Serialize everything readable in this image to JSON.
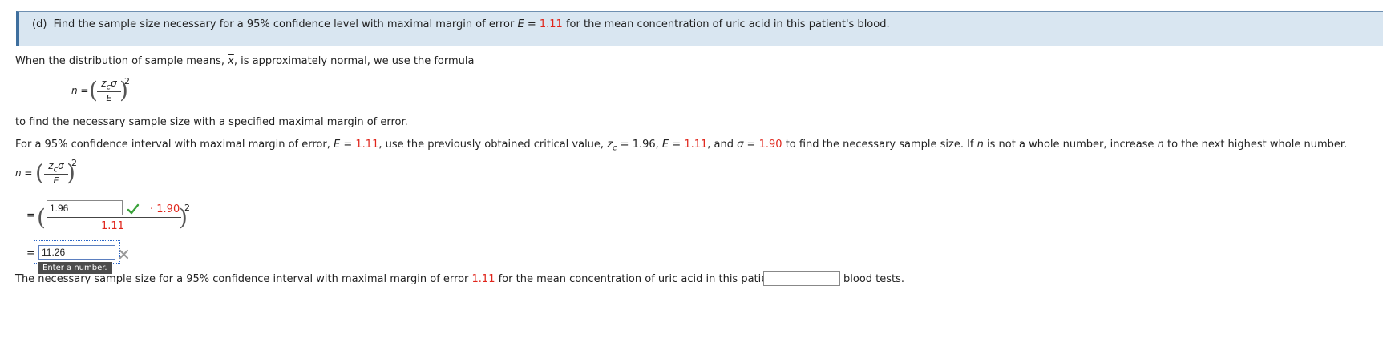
{
  "question": {
    "part": "(d)",
    "prefix": "Find the sample size necessary for a 95% confidence level with maximal margin of error",
    "E_symbol": "E",
    "eq": "=",
    "E_value": "1.11",
    "suffix": "for the mean concentration of uric acid in this patient's blood."
  },
  "intro": {
    "text_a": "When the distribution of sample means,",
    "xbar": "x",
    "text_b": ", is approximately normal, we use the formula"
  },
  "formula": {
    "lhs": "n =",
    "numer_z": "z",
    "numer_c": "c",
    "numer_sigma": "σ",
    "denom": "E",
    "exp": "2"
  },
  "purpose_text": "to find the necessary sample size with a specified maximal margin of error.",
  "instructions": {
    "t1": "For a 95% confidence interval with maximal margin of error,",
    "E1": "E",
    "eq1": "=",
    "E1_val": "1.11",
    "t2": ", use the previously obtained critical value,",
    "zc": "z",
    "zc_sub": "c",
    "eq2": "= 1.96,",
    "E2": "E",
    "eq3": "=",
    "E2_val": "1.11",
    "t3": ", and",
    "sigma": "σ",
    "eq4": "=",
    "sigma_val": "1.90",
    "t4": "to find the necessary sample size. If",
    "n1": "n",
    "t5": "is not a whole number, increase",
    "n2": "n",
    "t6": "to the next highest whole number."
  },
  "work": {
    "lhs": "n =",
    "eq_sign": "=",
    "zc_input_value": "1.96",
    "dot_sigma": "· 1.90",
    "denom_value": "1.11",
    "exp": "2",
    "result_eq": "=",
    "result_input_value": "11.26",
    "tooltip": "Enter a number."
  },
  "answer": {
    "text_a": "The necessary sample size for a 95% confidence interval with maximal margin of error",
    "E_val": "1.11",
    "text_b": "for the mean concentration of uric acid in this patient's blood is",
    "input_value": "",
    "text_c": "blood tests."
  },
  "colors": {
    "accent_red": "#e0251b",
    "check_green": "#3aa23a",
    "cross_gray": "#9a9a9a",
    "banner_bg": "#d9e6f1"
  },
  "icons": {
    "correct": "checkmark-icon",
    "incorrect": "cross-icon"
  }
}
